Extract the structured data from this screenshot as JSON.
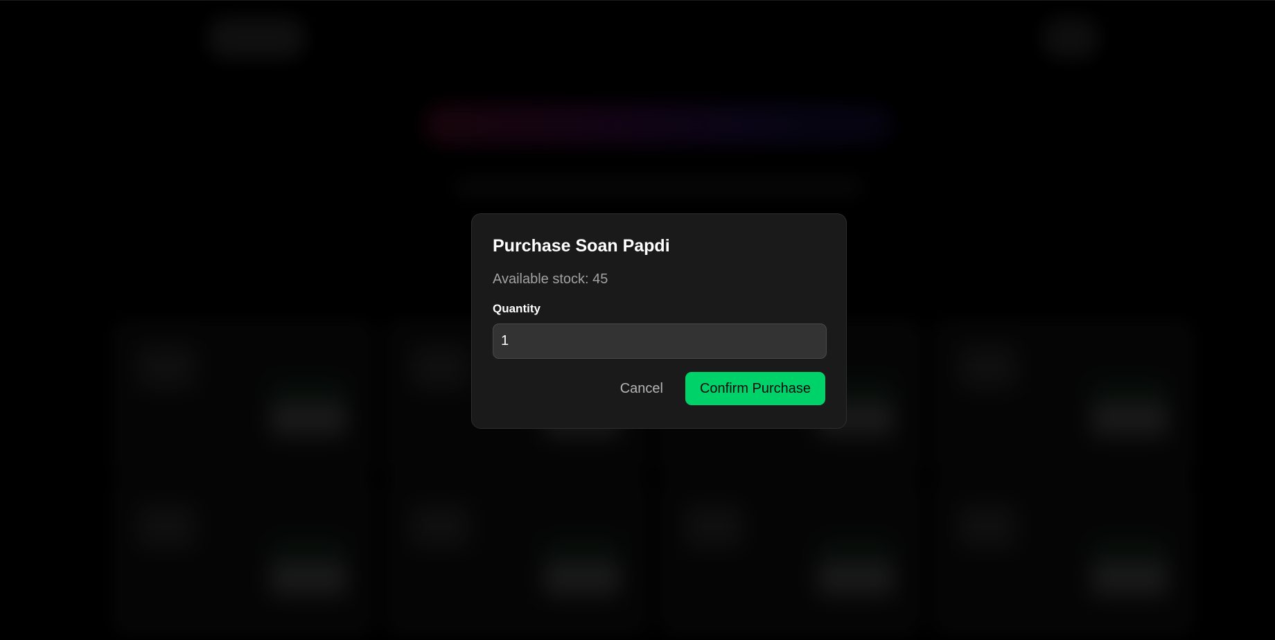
{
  "modal": {
    "title": "Purchase Soan Papdi",
    "stock_text": "Available stock: 45",
    "quantity_label": "Quantity",
    "quantity_value": "1",
    "cancel_label": "Cancel",
    "confirm_label": "Confirm Purchase"
  },
  "colors": {
    "background": "#000000",
    "modal_bg": "#1a1a1a",
    "input_bg": "#333333",
    "accent": "#00d26a",
    "muted_text": "#a3a3a3"
  }
}
